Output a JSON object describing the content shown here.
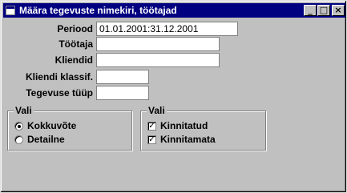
{
  "window": {
    "title": "Määra tegevuste nimekiri, töötajad",
    "minimize_glyph": "_",
    "maximize_glyph": "□",
    "close_glyph": "×"
  },
  "form": {
    "period": {
      "label": "Periood",
      "value": "01.01.2001:31.12.2001"
    },
    "employee": {
      "label": "Töötaja",
      "value": ""
    },
    "clients": {
      "label": "Kliendid",
      "value": ""
    },
    "client_class": {
      "label": "Kliendi klassif.",
      "value": ""
    },
    "activity_type": {
      "label": "Tegevuse tüüp",
      "value": ""
    }
  },
  "group_left": {
    "title": "Vali",
    "options": [
      {
        "label": "Kokkuvõte",
        "selected": true
      },
      {
        "label": "Detailne",
        "selected": false
      }
    ]
  },
  "group_right": {
    "title": "Vali",
    "options": [
      {
        "label": "Kinnitatud",
        "checked": true,
        "mark": "✓"
      },
      {
        "label": "Kinnitamata",
        "checked": true,
        "mark": "✓"
      }
    ]
  }
}
